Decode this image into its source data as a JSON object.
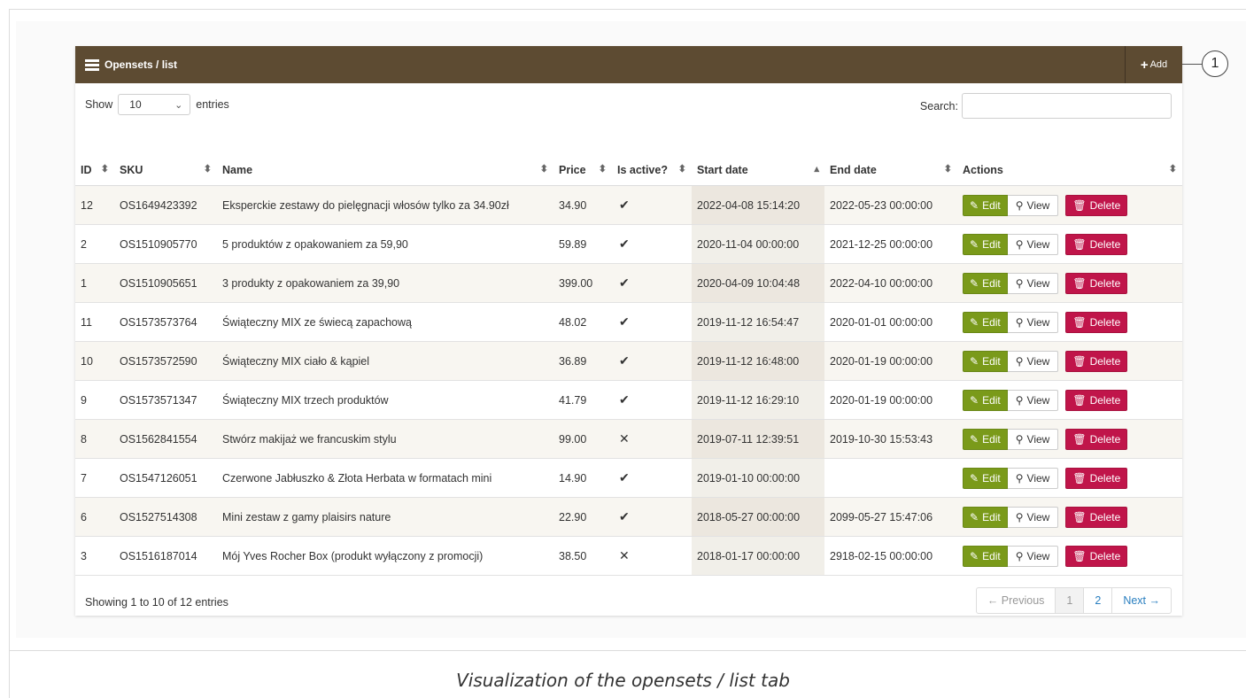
{
  "panel": {
    "title": "Opensets / list",
    "add_label": "Add",
    "callout_number": "1"
  },
  "controls": {
    "show_label": "Show",
    "entries_value": "10",
    "entries_label": "entries",
    "search_label": "Search:",
    "search_value": ""
  },
  "table": {
    "columns": [
      "ID",
      "SKU",
      "Name",
      "Price",
      "Is active?",
      "Start date",
      "End date",
      "Actions"
    ],
    "rows": [
      {
        "id": "12",
        "sku": "OS1649423392",
        "name": "Eksperckie zestawy do pielęgnacji włosów tylko za 34.90zł",
        "price": "34.90",
        "active": "✔",
        "start": "2022-04-08 15:14:20",
        "end": "2022-05-23 00:00:00"
      },
      {
        "id": "2",
        "sku": "OS1510905770",
        "name": "5 produktów z opakowaniem za 59,90",
        "price": "59.89",
        "active": "✔",
        "start": "2020-11-04 00:00:00",
        "end": "2021-12-25 00:00:00"
      },
      {
        "id": "1",
        "sku": "OS1510905651",
        "name": "3 produkty z opakowaniem za 39,90",
        "price": "399.00",
        "active": "✔",
        "start": "2020-04-09 10:04:48",
        "end": "2022-04-10 00:00:00"
      },
      {
        "id": "11",
        "sku": "OS1573573764",
        "name": "Świąteczny MIX ze świecą zapachową",
        "price": "48.02",
        "active": "✔",
        "start": "2019-11-12 16:54:47",
        "end": "2020-01-01 00:00:00"
      },
      {
        "id": "10",
        "sku": "OS1573572590",
        "name": "Świąteczny MIX ciało & kąpiel",
        "price": "36.89",
        "active": "✔",
        "start": "2019-11-12 16:48:00",
        "end": "2020-01-19 00:00:00"
      },
      {
        "id": "9",
        "sku": "OS1573571347",
        "name": "Świąteczny MIX trzech produktów",
        "price": "41.79",
        "active": "✔",
        "start": "2019-11-12 16:29:10",
        "end": "2020-01-19 00:00:00"
      },
      {
        "id": "8",
        "sku": "OS1562841554",
        "name": "Stwórz makijaż we francuskim stylu",
        "price": "99.00",
        "active": "✕",
        "start": "2019-07-11 12:39:51",
        "end": "2019-10-30 15:53:43"
      },
      {
        "id": "7",
        "sku": "OS1547126051",
        "name": "Czerwone Jabłuszko & Złota Herbata w formatach mini",
        "price": "14.90",
        "active": "✔",
        "start": "2019-01-10 00:00:00",
        "end": ""
      },
      {
        "id": "6",
        "sku": "OS1527514308",
        "name": "Mini zestaw z gamy plaisirs nature",
        "price": "22.90",
        "active": "✔",
        "start": "2018-05-27 00:00:00",
        "end": "2099-05-27 15:47:06"
      },
      {
        "id": "3",
        "sku": "OS1516187014",
        "name": "Mój Yves Rocher Box (produkt wyłączony z promocji)",
        "price": "38.50",
        "active": "✕",
        "start": "2018-01-17 00:00:00",
        "end": "2918-02-15 00:00:00"
      }
    ],
    "actions": {
      "edit": "Edit",
      "view": "View",
      "delete": "Delete"
    }
  },
  "footer": {
    "info": "Showing 1 to 10 of 12 entries",
    "prev": "← Previous",
    "pages": [
      "1",
      "2"
    ],
    "next": "Next →"
  },
  "caption": "Visualization of the opensets / list tab",
  "colors": {
    "header": "#5d4b32",
    "edit": "#7a9a1a",
    "delete": "#c0154a"
  }
}
